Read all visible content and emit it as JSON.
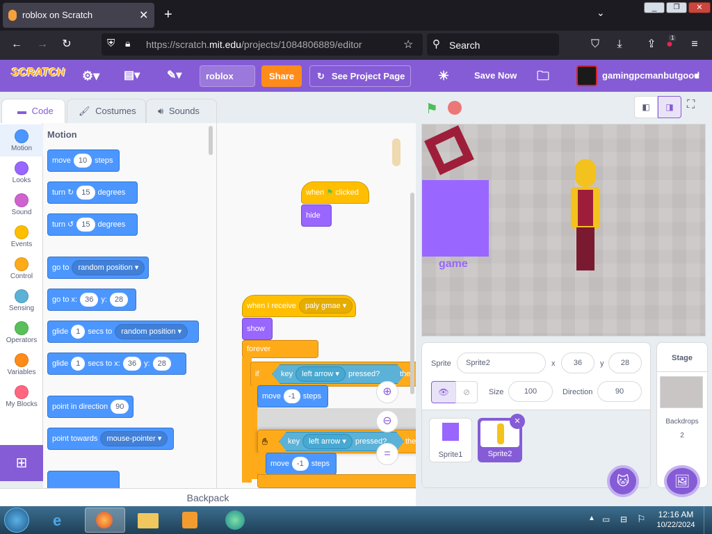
{
  "browser": {
    "tab_title": "roblox on Scratch",
    "url_prefix": "https://scratch.",
    "url_domain": "mit.edu",
    "url_path": "/projects/1084806889/editor",
    "search_placeholder": "Search",
    "badge_count": "1"
  },
  "menu": {
    "logo": "SCRATCH",
    "project_title": "roblox",
    "share_label": "Share",
    "see_project_label": "See Project Page",
    "save_label": "Save Now",
    "username": "gamingpcmanbutgood"
  },
  "editor_tabs": {
    "code": "Code",
    "costumes": "Costumes",
    "sounds": "Sounds"
  },
  "categories": [
    {
      "label": "Motion",
      "color": "#4c97ff"
    },
    {
      "label": "Looks",
      "color": "#9966ff"
    },
    {
      "label": "Sound",
      "color": "#cf63cf"
    },
    {
      "label": "Events",
      "color": "#ffbf00"
    },
    {
      "label": "Control",
      "color": "#ffab19"
    },
    {
      "label": "Sensing",
      "color": "#5cb1d6"
    },
    {
      "label": "Operators",
      "color": "#59c059"
    },
    {
      "label": "Variables",
      "color": "#ff8c1a"
    },
    {
      "label": "My Blocks",
      "color": "#ff6680"
    }
  ],
  "palette": {
    "heading": "Motion",
    "move": {
      "a": "move",
      "v": "10",
      "b": "steps"
    },
    "turn_right": {
      "a": "turn",
      "v": "15",
      "b": "degrees"
    },
    "turn_left": {
      "a": "turn",
      "v": "15",
      "b": "degrees"
    },
    "go_to": {
      "a": "go to",
      "opt": "random position"
    },
    "go_to_xy": {
      "a": "go to x:",
      "x": "36",
      "ylbl": "y:",
      "y": "28"
    },
    "glide_to": {
      "a": "glide",
      "v": "1",
      "b": "secs to",
      "opt": "random position"
    },
    "glide_xy": {
      "a": "glide",
      "v": "1",
      "b": "secs to x:",
      "x": "36",
      "ylbl": "y:",
      "y": "28"
    },
    "point_dir": {
      "a": "point in direction",
      "v": "90"
    },
    "point_towards": {
      "a": "point towards",
      "opt": "mouse-pointer"
    }
  },
  "scripts": {
    "when_clicked_a": "when",
    "when_clicked_b": "clicked",
    "hide": "hide",
    "when_receive": "when I receive",
    "receive_msg": "paly gmae",
    "show": "show",
    "forever": "forever",
    "if_a": "if",
    "if_then": "then",
    "key_a": "key",
    "key_opt": "left arrow",
    "key_b": "pressed?",
    "move_a": "move",
    "move_v": "-1",
    "move_b": "steps",
    "drag_key_a": "key",
    "drag_key_opt": "left arrow",
    "drag_key_b": "pressed?",
    "drag_then": "then",
    "drag_move_a": "move",
    "drag_move_v": "-1",
    "drag_move_b": "steps"
  },
  "backpack": "Backpack",
  "stage": {
    "text": "game"
  },
  "sprite_info": {
    "sprite_label": "Sprite",
    "sprite_name": "Sprite2",
    "x_label": "x",
    "x": "36",
    "y_label": "y",
    "y": "28",
    "show_label": "Show",
    "size_label": "Size",
    "size": "100",
    "direction_label": "Direction",
    "direction": "90"
  },
  "sprites": [
    {
      "name": "Sprite1"
    },
    {
      "name": "Sprite2"
    }
  ],
  "stage_pane": {
    "title": "Stage",
    "backdrops_label": "Backdrops",
    "backdrops_count": "2"
  },
  "taskbar": {
    "time": "12:16 AM",
    "date": "10/22/2024"
  },
  "colors": {
    "scratch_purple": "#855cd6",
    "motion": "#4c97ff",
    "events": "#ffbf00",
    "control": "#ffab19",
    "sensing": "#5cb1d6",
    "looks": "#9966ff"
  }
}
